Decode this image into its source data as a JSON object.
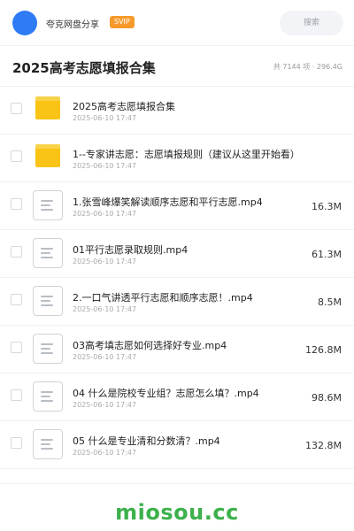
{
  "header": {
    "owner_name": "夸克网盘分享",
    "badge": "SVIP",
    "search_label": "搜索"
  },
  "folder": {
    "title": "2025高考志愿填报合集",
    "summary": "共 7144 项 · 296.4G"
  },
  "items": [
    {
      "type": "folder",
      "name": "2025高考志愿填报合集",
      "date": "2025-06-10 17:47",
      "size": ""
    },
    {
      "type": "folder",
      "name": "1--专家讲志愿：志愿填报规则（建议从这里开始看）",
      "date": "2025-06-10 17:47",
      "size": ""
    },
    {
      "type": "file",
      "name": "1.张雪峰爆笑解读顺序志愿和平行志愿.mp4",
      "date": "2025-06-10 17:47",
      "size": "16.3M"
    },
    {
      "type": "file",
      "name": "01平行志愿录取规则.mp4",
      "date": "2025-06-10 17:47",
      "size": "61.3M"
    },
    {
      "type": "file",
      "name": "2.一口气讲透平行志愿和顺序志愿！.mp4",
      "date": "2025-06-10 17:47",
      "size": "8.5M"
    },
    {
      "type": "file",
      "name": "03高考填志愿如何选择好专业.mp4",
      "date": "2025-06-10 17:47",
      "size": "126.8M"
    },
    {
      "type": "file",
      "name": "04 什么是院校专业组？志愿怎么填？.mp4",
      "date": "2025-06-10 17:47",
      "size": "98.6M"
    },
    {
      "type": "file",
      "name": "05 什么是专业清和分数清？.mp4",
      "date": "2025-06-10 17:47",
      "size": "132.8M"
    }
  ],
  "watermark": "miosou.cc",
  "colors": {
    "avatar": "#2f7bf6",
    "svip": "#f79a2c",
    "folder": "#fac416",
    "watermark": "#3cb14c"
  },
  "icons": {
    "folder": "folder-icon",
    "file": "document-icon"
  }
}
